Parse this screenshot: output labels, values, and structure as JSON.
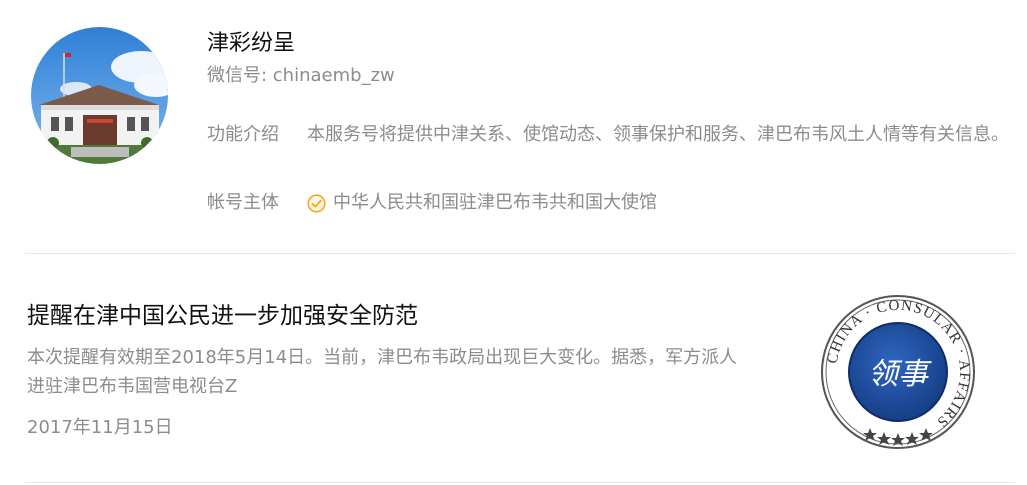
{
  "profile": {
    "name": "津彩纷呈",
    "wechat_id": "微信号: chinaemb_zw",
    "intro_label": "功能介绍",
    "intro_text": "本服务号将提供中津关系、使馆动态、领事保护和服务、津巴布韦风土人情等有关信息。",
    "owner_label": "帐号主体",
    "owner_text": "中华人民共和国驻津巴布韦共和国大使馆",
    "verify_icon": "verified-check-icon",
    "verify_color": "#f5a623"
  },
  "article": {
    "title": "提醒在津中国公民进一步加强安全防范",
    "summary": "本次提醒有效期至2018年5月14日。当前，津巴布韦政局出现巨大变化。据悉，军方派人进驻津巴布韦国营电视台Z",
    "date": "2017年11月15日",
    "thumbnail": {
      "ring_text": "CHINA · CONSULAR · AFFAIRS",
      "center_text": "领事",
      "ring_color": "#1f4e9c"
    }
  }
}
